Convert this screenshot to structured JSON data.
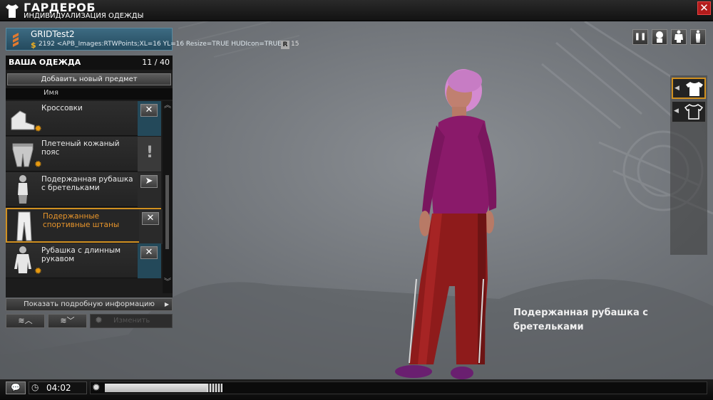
{
  "header": {
    "title": "ГАРДЕРОБ",
    "subtitle": "ИНДИВИДУАЛИЗАЦИЯ ОДЕЖДЫ",
    "close_label": "✕"
  },
  "player": {
    "name": "GRIDTest2",
    "info": "2192 <APB_Images:RTWPoints;XL=16 YL=16 Resize=TRUE HUDIcon=TRUE>",
    "rank_letter": "R",
    "rank_num": "15"
  },
  "panel": {
    "title": "ВАША ОДЕЖДА",
    "count": "11 / 40",
    "add_button": "Добавить новый предмет",
    "column_header": "Имя",
    "items": [
      {
        "name": "Кроссовки",
        "action": "✕"
      },
      {
        "name": "Плетеный кожаный пояс",
        "action": "!"
      },
      {
        "name": "Подержанная рубашка с бретельками",
        "action": "➤"
      },
      {
        "name": "Подержанные спортивные штаны",
        "action": "✕"
      },
      {
        "name": "Рубашка с длинным рукавом",
        "action": "✕"
      }
    ],
    "details_button": "Показать подробную информацию",
    "change_button": "Изменить"
  },
  "caption": "Подержанная рубашка с бретельками",
  "bottom": {
    "time": "04:02",
    "progress": 0.17
  },
  "colors": {
    "accent": "#d09020",
    "action_bg": "#24495a",
    "close_red": "#b31c1c",
    "shirt": "#8a1a6a",
    "pants": "#8e1b1b",
    "hair": "#d48ad0"
  }
}
